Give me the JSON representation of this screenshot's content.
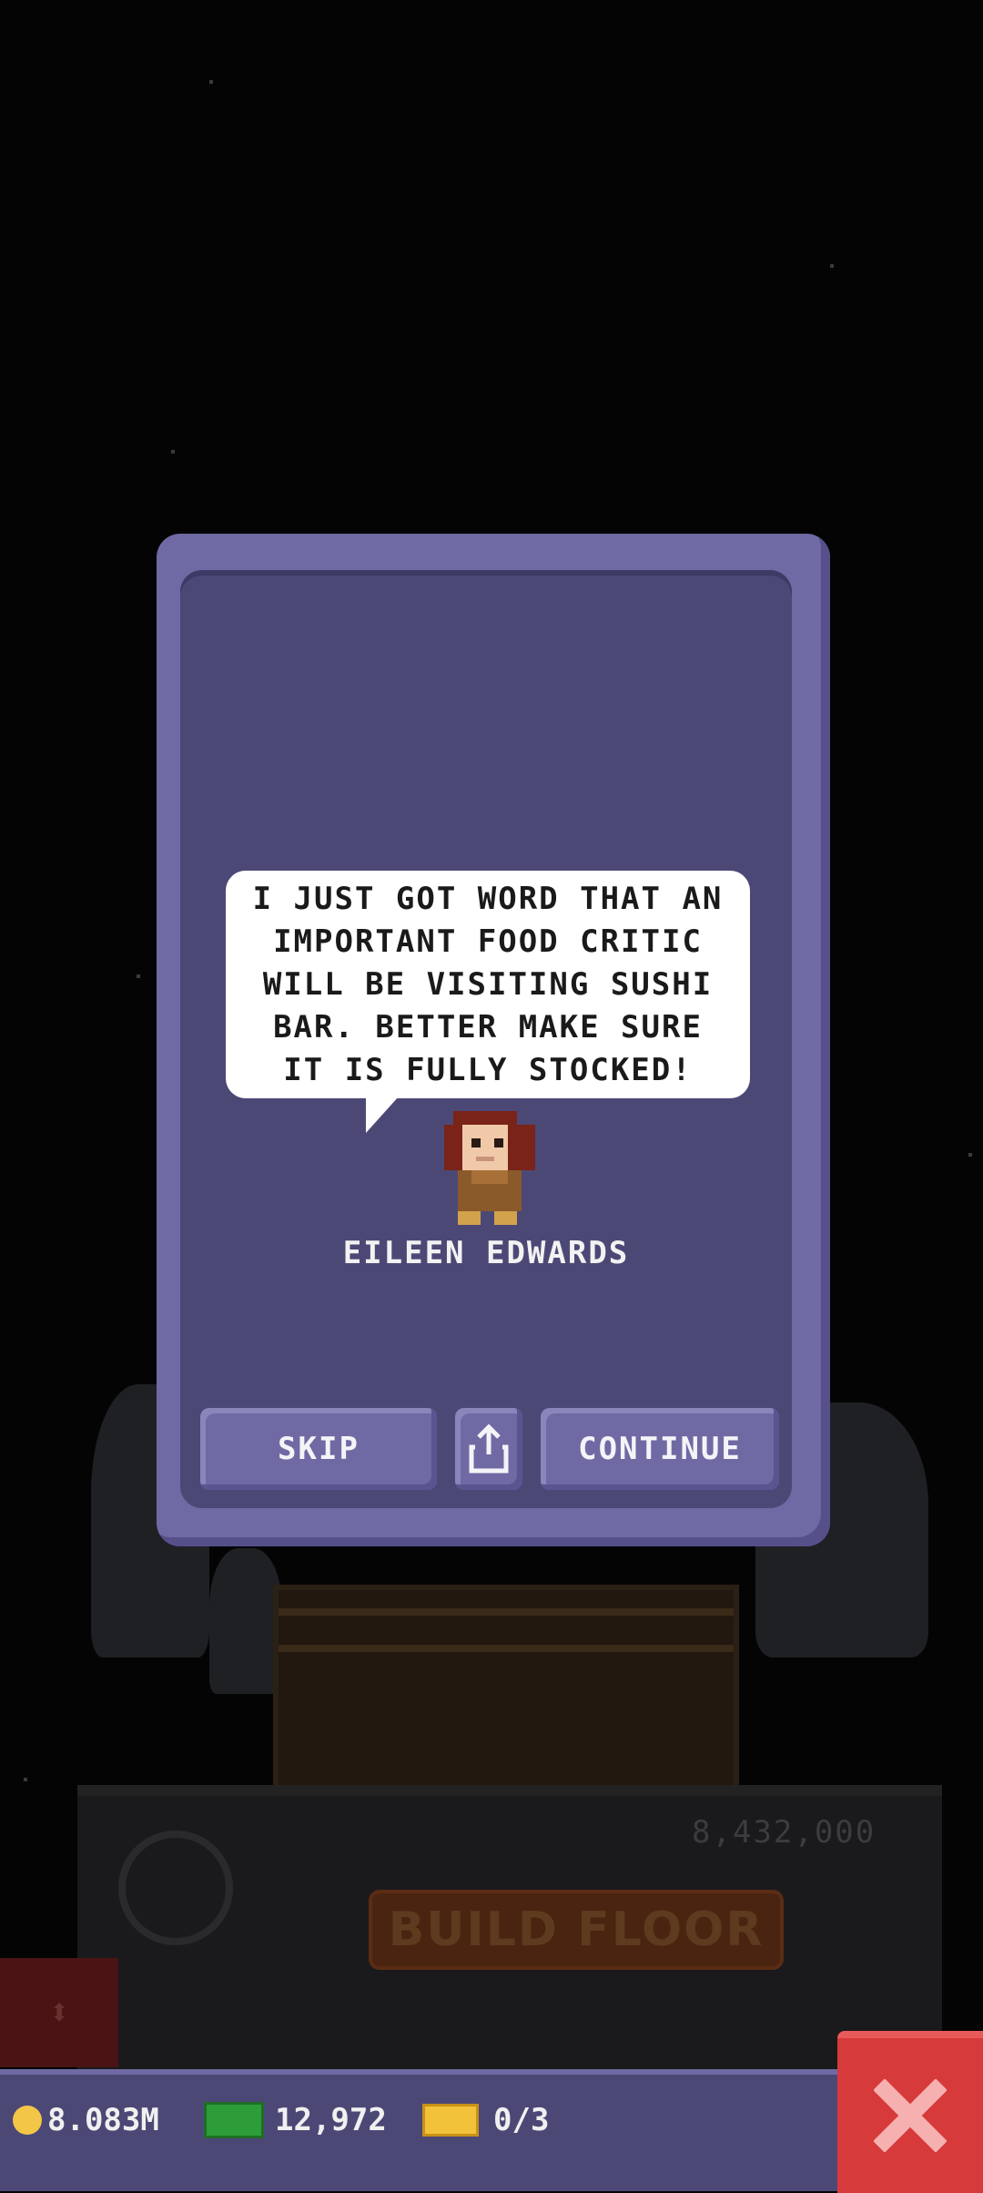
{
  "dialog": {
    "message": "I JUST GOT WORD THAT AN IMPORTANT FOOD CRITIC WILL BE VISITING SUSHI BAR. BETTER MAKE SURE IT IS FULLY STOCKED!",
    "character_name": "EILEEN EDWARDS",
    "skip_label": "SKIP",
    "continue_label": "CONTINUE",
    "share_icon": "share-icon"
  },
  "background": {
    "floor_price": "8,432,000",
    "build_floor_label": "BUILD FLOOR"
  },
  "status_bar": {
    "coins": "8.083M",
    "bux": "12,972",
    "tickets": "0/3",
    "close_icon": "close-icon"
  },
  "colors": {
    "dialog_frame": "#6f6aa3",
    "dialog_inner": "#4c4876",
    "close_button": "#d63a3a"
  }
}
